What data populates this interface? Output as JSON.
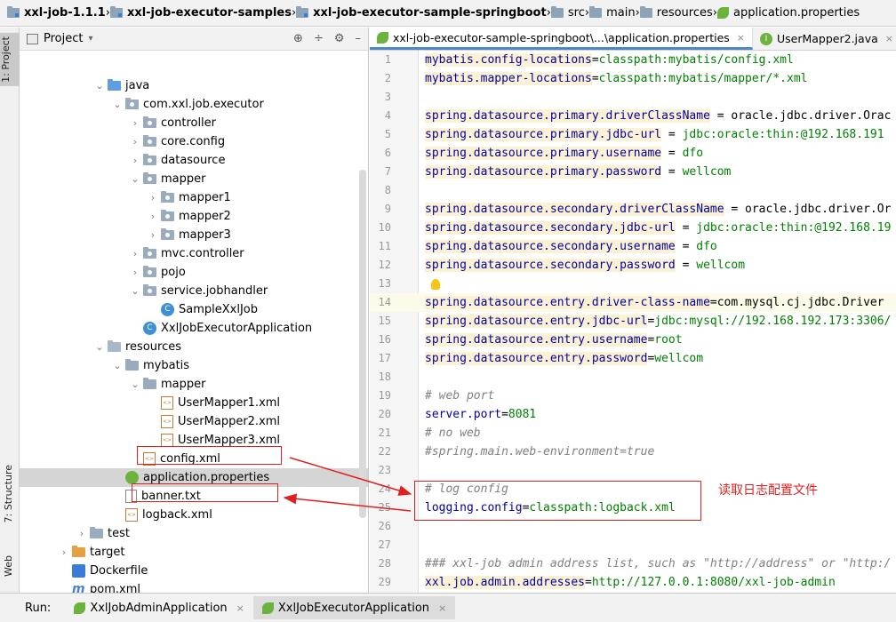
{
  "breadcrumb": [
    "xxl-job-1.1.1",
    "xxl-job-executor-samples",
    "xxl-job-executor-sample-springboot",
    "src",
    "main",
    "resources",
    "application.properties"
  ],
  "left_strip": {
    "project_tab": "1: Project",
    "structure_tab": "7: Structure",
    "web_tab": "Web"
  },
  "project_panel": {
    "title": "Project",
    "dropdown_glyph": "▾",
    "tools": [
      "⊕",
      "÷",
      "⚙",
      "–"
    ]
  },
  "tree": [
    {
      "label": "java",
      "depth": 5,
      "expanded": true,
      "icon": "folder-src"
    },
    {
      "label": "com.xxl.job.executor",
      "depth": 6,
      "expanded": true,
      "icon": "package"
    },
    {
      "label": "controller",
      "depth": 7,
      "expanded": false,
      "icon": "package"
    },
    {
      "label": "core.config",
      "depth": 7,
      "expanded": false,
      "icon": "package"
    },
    {
      "label": "datasource",
      "depth": 7,
      "expanded": false,
      "icon": "package"
    },
    {
      "label": "mapper",
      "depth": 7,
      "expanded": true,
      "icon": "package"
    },
    {
      "label": "mapper1",
      "depth": 8,
      "expanded": false,
      "icon": "package"
    },
    {
      "label": "mapper2",
      "depth": 8,
      "expanded": false,
      "icon": "package"
    },
    {
      "label": "mapper3",
      "depth": 8,
      "expanded": false,
      "icon": "package"
    },
    {
      "label": "mvc.controller",
      "depth": 7,
      "expanded": false,
      "icon": "package"
    },
    {
      "label": "pojo",
      "depth": 7,
      "expanded": false,
      "icon": "package"
    },
    {
      "label": "service.jobhandler",
      "depth": 7,
      "expanded": true,
      "icon": "package"
    },
    {
      "label": "SampleXxlJob",
      "depth": 8,
      "expanded": null,
      "icon": "class"
    },
    {
      "label": "XxlJobExecutorApplication",
      "depth": 7,
      "expanded": null,
      "icon": "class"
    },
    {
      "label": "resources",
      "depth": 5,
      "expanded": true,
      "icon": "folder-res"
    },
    {
      "label": "mybatis",
      "depth": 6,
      "expanded": true,
      "icon": "folder"
    },
    {
      "label": "mapper",
      "depth": 7,
      "expanded": true,
      "icon": "folder"
    },
    {
      "label": "UserMapper1.xml",
      "depth": 8,
      "expanded": null,
      "icon": "xml"
    },
    {
      "label": "UserMapper2.xml",
      "depth": 8,
      "expanded": null,
      "icon": "xml"
    },
    {
      "label": "UserMapper3.xml",
      "depth": 8,
      "expanded": null,
      "icon": "xml"
    },
    {
      "label": "config.xml",
      "depth": 7,
      "expanded": null,
      "icon": "xml"
    },
    {
      "label": "application.properties",
      "depth": 6,
      "expanded": null,
      "icon": "props",
      "selected": true
    },
    {
      "label": "banner.txt",
      "depth": 6,
      "expanded": null,
      "icon": "txt"
    },
    {
      "label": "logback.xml",
      "depth": 6,
      "expanded": null,
      "icon": "xml"
    },
    {
      "label": "test",
      "depth": 4,
      "expanded": false,
      "icon": "folder"
    },
    {
      "label": "target",
      "depth": 3,
      "expanded": false,
      "icon": "folder-orange"
    },
    {
      "label": "Dockerfile",
      "depth": 3,
      "expanded": null,
      "icon": "docker"
    },
    {
      "label": "pom.xml",
      "depth": 3,
      "expanded": null,
      "icon": "maven"
    },
    {
      "label": "xxl-job-executor-sample-springboot.iml",
      "depth": 3,
      "expanded": null,
      "icon": "iml"
    }
  ],
  "editor_tabs": [
    {
      "label": "xxl-job-executor-sample-springboot\\...\\application.properties",
      "active": true,
      "close": "×"
    },
    {
      "label": "UserMapper2.java",
      "active": false,
      "close": "×"
    },
    {
      "label": "C",
      "active": false,
      "close": ""
    }
  ],
  "code_lines": [
    {
      "n": "1",
      "parts": [
        [
          "key",
          "mybatis.config-locations"
        ],
        [
          "eq",
          "="
        ],
        [
          "val",
          "classpath:mybatis/config.xml"
        ]
      ]
    },
    {
      "n": "2",
      "parts": [
        [
          "key",
          "mybatis.mapper-locations"
        ],
        [
          "eq",
          "="
        ],
        [
          "val",
          "classpath:mybatis/mapper/*.xml"
        ]
      ]
    },
    {
      "n": "3",
      "parts": []
    },
    {
      "n": "4",
      "parts": [
        [
          "key",
          "spring.datasource.primary.driverClassName"
        ],
        [
          "eq",
          " = "
        ],
        [
          "eq",
          "oracle.jdbc.driver.Orac"
        ]
      ]
    },
    {
      "n": "5",
      "parts": [
        [
          "key",
          "spring.datasource.primary.jdbc-url"
        ],
        [
          "eq",
          " = "
        ],
        [
          "val",
          "jdbc:oracle:thin:@192.168.191"
        ]
      ]
    },
    {
      "n": "6",
      "parts": [
        [
          "key",
          "spring.datasource.primary.username"
        ],
        [
          "eq",
          " = "
        ],
        [
          "val",
          "dfo"
        ]
      ]
    },
    {
      "n": "7",
      "parts": [
        [
          "key",
          "spring.datasource.primary.password"
        ],
        [
          "eq",
          " = "
        ],
        [
          "val",
          "wellcom"
        ]
      ]
    },
    {
      "n": "8",
      "parts": []
    },
    {
      "n": "9",
      "parts": [
        [
          "key",
          "spring.datasource.secondary.driverClassName"
        ],
        [
          "eq",
          " = "
        ],
        [
          "eq",
          "oracle.jdbc.driver.Or"
        ]
      ]
    },
    {
      "n": "10",
      "parts": [
        [
          "key",
          "spring.datasource.secondary.jdbc-url"
        ],
        [
          "eq",
          " = "
        ],
        [
          "val",
          "jdbc:oracle:thin:@192.168.19"
        ]
      ]
    },
    {
      "n": "11",
      "parts": [
        [
          "key",
          "spring.datasource.secondary.username"
        ],
        [
          "eq",
          " = "
        ],
        [
          "val",
          "dfo"
        ]
      ]
    },
    {
      "n": "12",
      "parts": [
        [
          "key",
          "spring.datasource.secondary.password"
        ],
        [
          "eq",
          " = "
        ],
        [
          "val",
          "wellcom"
        ]
      ]
    },
    {
      "n": "13",
      "parts": []
    },
    {
      "n": "14",
      "parts": [
        [
          "key",
          "spring.datasource.entry.driver-class-name"
        ],
        [
          "eq",
          "="
        ],
        [
          "eq",
          "com.mysql.cj.jdbc.Driver"
        ]
      ]
    },
    {
      "n": "15",
      "parts": [
        [
          "key",
          "spring.datasource.entry.jdbc-url"
        ],
        [
          "eq",
          "="
        ],
        [
          "val",
          "jdbc:mysql://192.168.192.173:3306/"
        ]
      ]
    },
    {
      "n": "16",
      "parts": [
        [
          "key",
          "spring.datasource.entry.username"
        ],
        [
          "eq",
          "="
        ],
        [
          "val",
          "root"
        ]
      ]
    },
    {
      "n": "17",
      "parts": [
        [
          "key",
          "spring.datasource.entry.password"
        ],
        [
          "eq",
          "="
        ],
        [
          "val",
          "wellcom"
        ]
      ]
    },
    {
      "n": "18",
      "parts": []
    },
    {
      "n": "19",
      "parts": [
        [
          "cmt",
          "# web port"
        ]
      ]
    },
    {
      "n": "20",
      "parts": [
        [
          "key2",
          "server.port"
        ],
        [
          "eq",
          "="
        ],
        [
          "val",
          "8081"
        ]
      ]
    },
    {
      "n": "21",
      "parts": [
        [
          "cmt",
          "# no web"
        ]
      ]
    },
    {
      "n": "22",
      "parts": [
        [
          "cmt",
          "#spring.main.web-environment=true"
        ]
      ]
    },
    {
      "n": "23",
      "parts": []
    },
    {
      "n": "24",
      "parts": [
        [
          "cmt",
          "# log config"
        ]
      ]
    },
    {
      "n": "25",
      "parts": [
        [
          "key2",
          "logging.config"
        ],
        [
          "eq",
          "="
        ],
        [
          "val",
          "classpath:logback.xml"
        ]
      ]
    },
    {
      "n": "26",
      "parts": []
    },
    {
      "n": "27",
      "parts": []
    },
    {
      "n": "28",
      "parts": [
        [
          "cmt",
          "### xxl-job admin address list, such as \"http://address\" or \"http:/"
        ]
      ]
    },
    {
      "n": "29",
      "parts": [
        [
          "key",
          "xxl.job.admin.addresses"
        ],
        [
          "eq",
          "="
        ],
        [
          "val",
          "http://127.0.0.1:8080/xxl-job-admin"
        ]
      ]
    }
  ],
  "annotation": "读取日志配置文件",
  "run_bar": {
    "label": "Run:",
    "tabs": [
      {
        "label": "XxlJobAdminApplication",
        "active": false
      },
      {
        "label": "XxlJobExecutorApplication",
        "active": true
      }
    ],
    "close": "×"
  },
  "colors": {
    "annotation": "#e02020",
    "key": "#0000a0",
    "value": "#008000",
    "comment": "#808080",
    "selected_row": "#d5d5d5"
  }
}
